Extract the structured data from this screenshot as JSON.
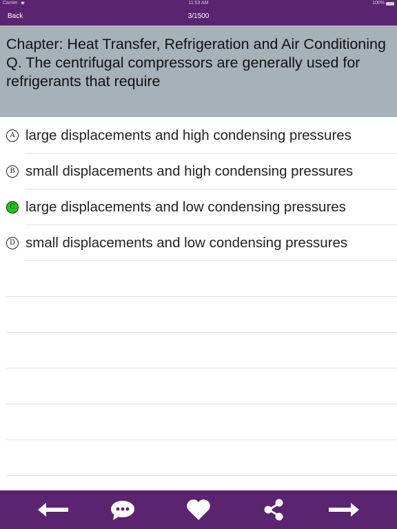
{
  "status_bar": {
    "carrier": "Carrier",
    "time": "11:53 AM",
    "battery": "100%"
  },
  "nav": {
    "back_label": "Back",
    "title": "3/1500"
  },
  "question": {
    "chapter": "Chapter: Heat Transfer, Refrigeration and Air Conditioning",
    "text": "Q. The centrifugal compressors are generally used for refrigerants that require"
  },
  "options": [
    {
      "letter": "A",
      "text": "large displacements and high condensing pressures",
      "correct": false
    },
    {
      "letter": "B",
      "text": "small displacements and high condensing pressures",
      "correct": false
    },
    {
      "letter": "C",
      "text": "large displacements and low condensing pressures",
      "correct": true
    },
    {
      "letter": "D",
      "text": "small displacements and low condensing pressures",
      "correct": false
    }
  ],
  "toolbar": {
    "icons": [
      "arrow-left-icon",
      "comment-icon",
      "heart-icon",
      "share-icon",
      "arrow-right-icon"
    ]
  },
  "colors": {
    "bar": "#5a2470",
    "question_bg": "#a7b1b8",
    "correct": "#1ec51e"
  }
}
